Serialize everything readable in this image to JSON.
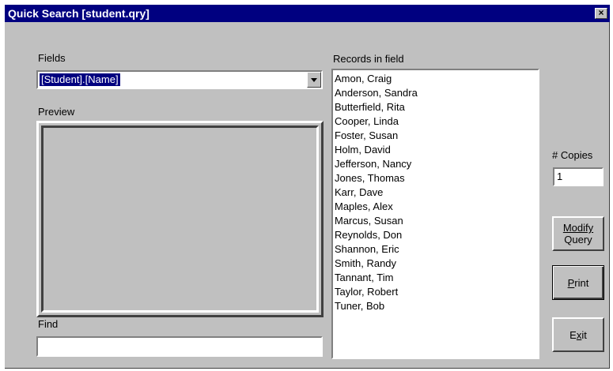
{
  "window": {
    "title": "Quick Search [student.qry]",
    "close": "×"
  },
  "fields": {
    "label": "Fields",
    "selected": "[Student].[Name]"
  },
  "preview": {
    "label": "Preview"
  },
  "find": {
    "label": "Find",
    "value": ""
  },
  "records": {
    "label": "Records in field",
    "items": [
      "Amon, Craig",
      "Anderson, Sandra",
      "Butterfield, Rita",
      "Cooper, Linda",
      "Foster, Susan",
      "Holm, David",
      "Jefferson, Nancy",
      "Jones, Thomas",
      "Karr, Dave",
      "Maples, Alex",
      "Marcus, Susan",
      "Reynolds, Don",
      "Shannon, Eric",
      "Smith, Randy",
      "Tannant, Tim",
      "Taylor, Robert",
      "Tuner, Bob"
    ]
  },
  "copies": {
    "label": "# Copies",
    "value": "1"
  },
  "buttons": {
    "modify_line1": "Modify",
    "modify_line2": "Query",
    "print_key": "P",
    "print_rest": "rint",
    "exit_first": "E",
    "exit_key": "x",
    "exit_rest": "it"
  }
}
